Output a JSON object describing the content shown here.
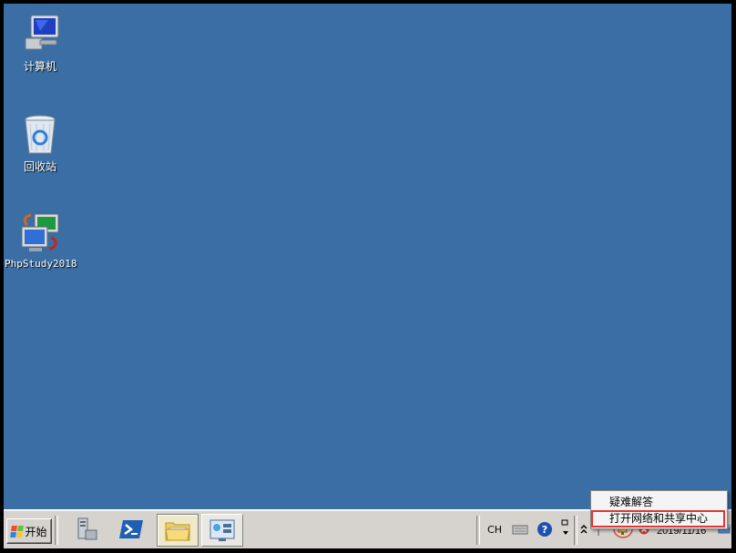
{
  "desktop": {
    "icons": [
      {
        "label": "计算机",
        "icon": "computer-icon"
      },
      {
        "label": "回收站",
        "icon": "recycle-bin-icon"
      },
      {
        "label": "PhpStudy2018",
        "icon": "phpstudy-icon"
      }
    ],
    "background_color": "#3a6ea5"
  },
  "taskbar": {
    "start_label": "开始",
    "quick_launch": [
      {
        "name": "server-manager",
        "icon": "server-manager-icon"
      },
      {
        "name": "powershell",
        "icon": "powershell-icon"
      },
      {
        "name": "explorer",
        "icon": "folder-icon"
      },
      {
        "name": "network-window",
        "icon": "network-window-icon"
      }
    ],
    "tray": {
      "language": "CH",
      "clock_date": "2019/11/16"
    }
  },
  "context_menu": {
    "items": [
      {
        "label": "疑难解答"
      },
      {
        "label": "打开网络和共享中心",
        "highlighted": true
      }
    ]
  }
}
